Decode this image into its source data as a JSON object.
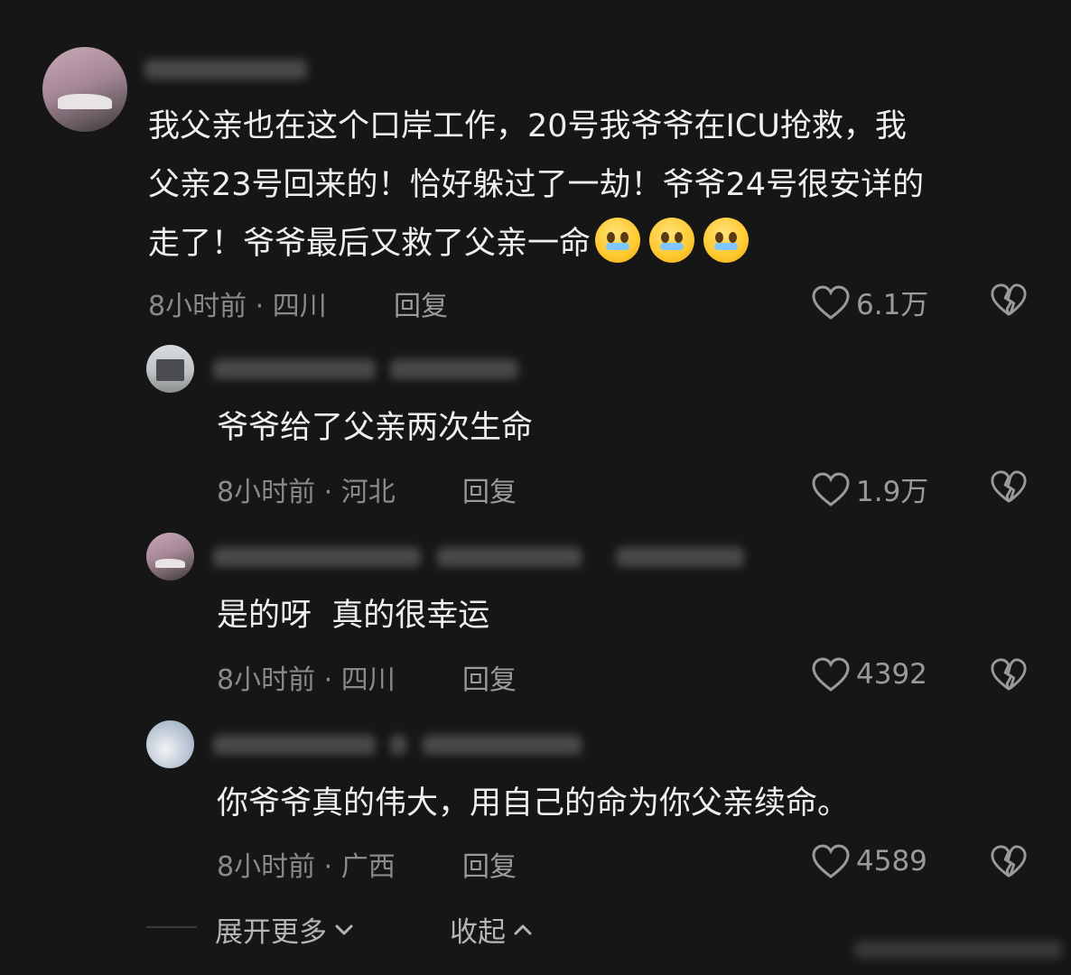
{
  "comments": [
    {
      "text_lines": [
        "我父亲也在这个口岸工作，20号我爷爷在ICU抢救，我",
        "父亲23号回来的！恰好躲过了一劫！爷爷24号很安详的",
        "走了！爷爷最后又救了父亲一命"
      ],
      "emoji_count_icon": "crying-pleading-face-icon",
      "time": "8小时前 · 四川",
      "reply": "回复",
      "likes": "6.1万"
    },
    {
      "text": "爷爷给了父亲两次生命",
      "time": "8小时前 · 河北",
      "reply": "回复",
      "likes": "1.9万"
    },
    {
      "text": "是的呀  真的很幸运",
      "time": "8小时前 · 四川",
      "reply": "回复",
      "likes": "4392"
    },
    {
      "text": "你爷爷真的伟大，用自己的命为你父亲续命。",
      "time": "8小时前 · 广西",
      "reply": "回复",
      "likes": "4589"
    }
  ],
  "footer": {
    "expand_more": "展开更多",
    "collapse": "收起"
  },
  "icons": {
    "like": "heart-outline-icon",
    "dislike": "broken-heart-icon"
  },
  "colors": {
    "background": "#161616",
    "text": "#efefef",
    "meta": "#8a8a8a"
  }
}
